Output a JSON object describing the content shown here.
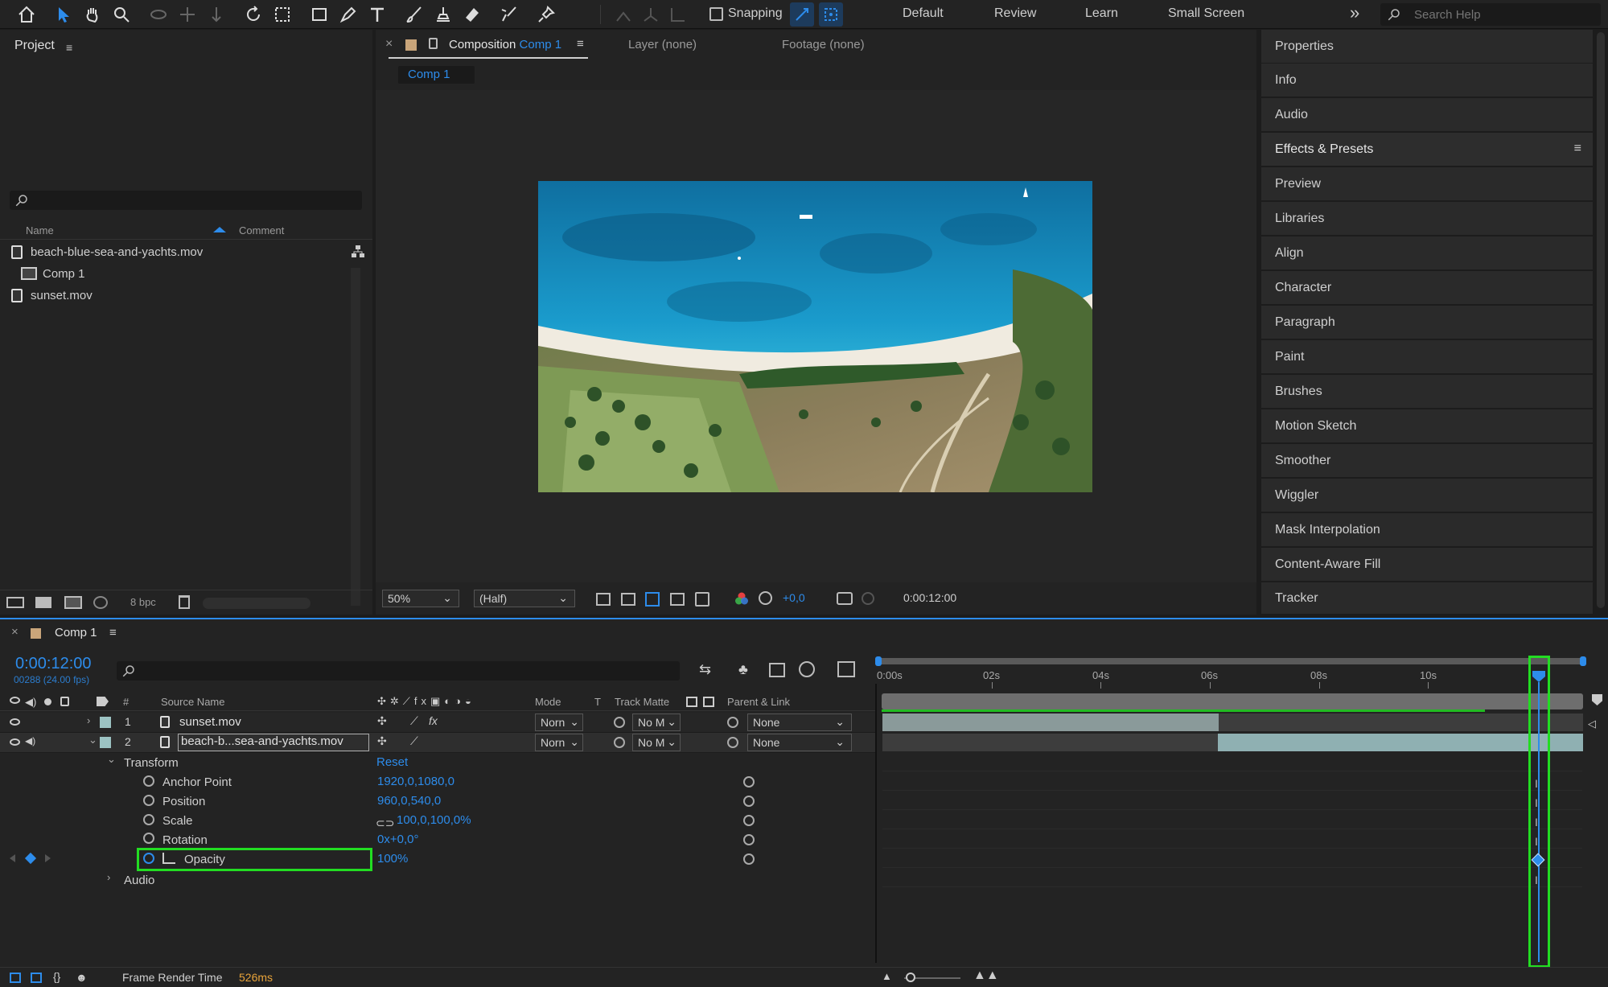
{
  "toolbar": {
    "snapping_label": "Snapping",
    "workspaces": [
      "Default",
      "Review",
      "Learn",
      "Small Screen"
    ],
    "overflow_label": "»",
    "search_placeholder": "Search Help"
  },
  "project": {
    "title": "Project",
    "search_placeholder": "",
    "col_name": "Name",
    "col_comment": "Comment",
    "items": [
      {
        "name": "beach-blue-sea-and-yachts.mov",
        "icon": "footage-icon"
      },
      {
        "name": "Comp 1",
        "icon": "composition-icon"
      },
      {
        "name": "sunset.mov",
        "icon": "footage-icon"
      }
    ],
    "bpc_label": "8 bpc"
  },
  "viewer": {
    "close_label": "×",
    "comp_tab_prefix": "Composition",
    "comp_tab_name": "Comp 1",
    "layer_tab": "Layer (none)",
    "footage_tab": "Footage (none)",
    "sub_tab": "Comp 1",
    "zoom": "50%",
    "resolution": "(Half)",
    "exposure": "+0,0",
    "timecode": "0:00:12:00"
  },
  "right_panels": {
    "items": [
      "Properties",
      "Info",
      "Audio",
      "Effects & Presets",
      "Preview",
      "Libraries",
      "Align",
      "Character",
      "Paragraph",
      "Paint",
      "Brushes",
      "Motion Sketch",
      "Smoother",
      "Wiggler",
      "Mask Interpolation",
      "Content-Aware Fill",
      "Tracker"
    ]
  },
  "timeline": {
    "close_label": "×",
    "comp_name": "Comp 1",
    "timecode": "0:00:12:00",
    "frame_info": "00288 (24.00 fps)",
    "headers": {
      "hash": "#",
      "source_name": "Source Name",
      "mode": "Mode",
      "t": "T",
      "track_matte": "Track Matte",
      "parent": "Parent & Link"
    },
    "layers": [
      {
        "num": "1",
        "name": "sunset.mov",
        "mode": "Norn",
        "matte": "No M",
        "parent": "None"
      },
      {
        "num": "2",
        "name": "beach-b...sea-and-yachts.mov",
        "mode": "Norn",
        "matte": "No M",
        "parent": "None"
      }
    ],
    "transform_label": "Transform",
    "reset_label": "Reset",
    "properties": [
      {
        "name": "Anchor Point",
        "value": "1920,0,1080,0"
      },
      {
        "name": "Position",
        "value": "960,0,540,0"
      },
      {
        "name": "Scale",
        "value": "100,0,100,0%"
      },
      {
        "name": "Rotation",
        "value": "0x+0,0°"
      },
      {
        "name": "Opacity",
        "value": "100%"
      }
    ],
    "audio_label": "Audio",
    "ruler": [
      "0:00s",
      "02s",
      "04s",
      "06s",
      "08s",
      "10s"
    ],
    "frame_render_label": "Frame Render Time",
    "frame_render_value": "526ms"
  },
  "colors": {
    "accent": "#2d8ceb",
    "highlight": "#22dd22",
    "render_time": "#e8a33a",
    "layer_label": "#9cc3c3"
  }
}
